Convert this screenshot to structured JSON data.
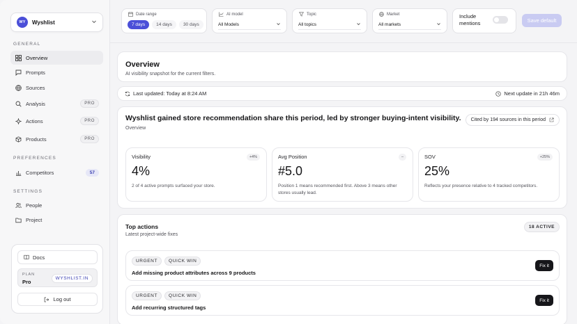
{
  "sidebar": {
    "workspace": {
      "initials": "WY",
      "name": "Wyshlist"
    },
    "sections": {
      "general": "GENERAL",
      "preferences": "PREFERENCES",
      "settings": "SETTINGS"
    },
    "items": [
      {
        "label": "Overview",
        "icon": "grid-icon",
        "active": true
      },
      {
        "label": "Prompts",
        "icon": "chat-icon"
      },
      {
        "label": "Sources",
        "icon": "globe-icon"
      },
      {
        "label": "Analysis",
        "icon": "search-icon",
        "badge": "PRO"
      },
      {
        "label": "Actions",
        "icon": "sparkle-icon",
        "badge": "PRO"
      },
      {
        "label": "Products",
        "icon": "box-icon",
        "badge": "PRO"
      },
      {
        "label": "Competitors",
        "icon": "bar-chart-icon",
        "count": "57"
      },
      {
        "label": "People",
        "icon": "users-icon"
      },
      {
        "label": "Project",
        "icon": "folder-icon"
      }
    ],
    "docs_label": "Docs",
    "plan": {
      "key": "PLAN",
      "value": "Pro",
      "link": "WYSHLIST.IN"
    },
    "logout_label": "Log out"
  },
  "filters": {
    "date_range": {
      "label": "Date range",
      "options": [
        "7 days",
        "14 days",
        "30 days"
      ],
      "selected": "7 days"
    },
    "ai_model": {
      "label": "AI model",
      "value": "All Models"
    },
    "topic": {
      "label": "Topic",
      "value": "All topics"
    },
    "market": {
      "label": "Market",
      "value": "All markets"
    },
    "include_mentions": {
      "label": "Include mentions",
      "on": false
    },
    "save_label": "Save default"
  },
  "overview": {
    "title": "Overview",
    "subtitle": "AI visibility snapshot for the current filters."
  },
  "update": {
    "last_updated": "Last updated: Today at 8:24 AM",
    "next_update": "Next update in 21h 46m"
  },
  "summary": {
    "headline": "Wyshlist gained store recommendation share this period, led by stronger buying-intent visibility.",
    "section": "Overview",
    "cited": "Cited by 194 sources in this period",
    "metrics": [
      {
        "label": "Visibility",
        "change": "+4%",
        "value": "4%",
        "desc": "2 of 4 active prompts surfaced your store."
      },
      {
        "label": "Avg Position",
        "change": "–",
        "value": "#5.0",
        "desc": "Position 1 means recommended first. Above 3 means other stores usually lead."
      },
      {
        "label": "SOV",
        "change": "+25%",
        "value": "25%",
        "desc": "Reflects your presence relative to 4 tracked competitors."
      }
    ]
  },
  "top_actions": {
    "title": "Top actions",
    "subtitle": "Latest project-wide fixes",
    "badge": "18 ACTIVE",
    "items": [
      {
        "tags": [
          "URGENT",
          "QUICK WIN"
        ],
        "title": "Add missing product attributes across 9 products",
        "button": "Fix it"
      },
      {
        "tags": [
          "URGENT",
          "QUICK WIN"
        ],
        "title": "Add recurring structured tags",
        "button": "Fix it"
      }
    ]
  },
  "colors": {
    "accent": "#4b4fd8",
    "background": "#f4f4f6",
    "button_dark": "#16161a"
  }
}
